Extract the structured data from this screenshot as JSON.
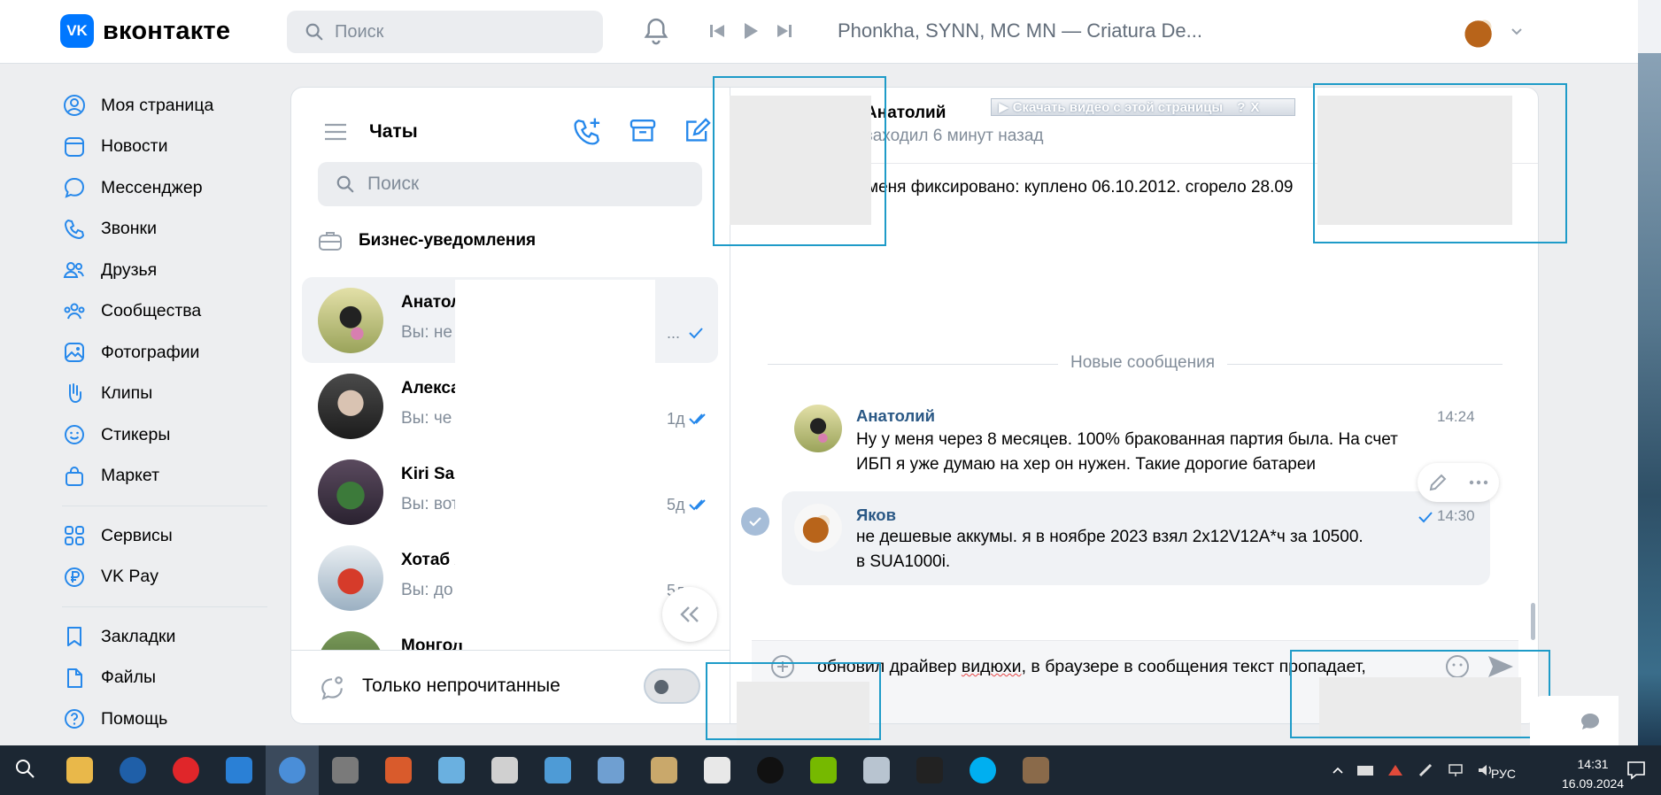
{
  "header": {
    "brand_mark": "VK",
    "brand_name": "вконтакте",
    "search_placeholder": "Поиск",
    "now_playing": "Phonkha, SYNN, MC MN — Criatura De..."
  },
  "nav": {
    "items": [
      {
        "label": "Моя страница",
        "icon": "user-circle-icon"
      },
      {
        "label": "Новости",
        "icon": "newspaper-icon"
      },
      {
        "label": "Мессенджер",
        "icon": "chat-bubble-icon"
      },
      {
        "label": "Звонки",
        "icon": "phone-icon"
      },
      {
        "label": "Друзья",
        "icon": "friends-icon"
      },
      {
        "label": "Сообщества",
        "icon": "communities-icon"
      },
      {
        "label": "Фотографии",
        "icon": "photo-icon"
      },
      {
        "label": "Клипы",
        "icon": "clips-icon"
      },
      {
        "label": "Стикеры",
        "icon": "smile-icon"
      },
      {
        "label": "Маркет",
        "icon": "shopping-bag-icon"
      }
    ],
    "items2": [
      {
        "label": "Сервисы",
        "icon": "grid-icon"
      },
      {
        "label": "VK Pay",
        "icon": "ruble-icon"
      }
    ],
    "items3": [
      {
        "label": "Закладки",
        "icon": "bookmark-icon"
      },
      {
        "label": "Файлы",
        "icon": "file-icon"
      },
      {
        "label": "Помощь",
        "icon": "help-icon"
      }
    ]
  },
  "chats": {
    "title": "Чаты",
    "search_placeholder": "Поиск",
    "business": "Бизнес-уведомления",
    "list": [
      {
        "name": "Анатол",
        "preview": "Вы: не",
        "date": "...",
        "read": "single"
      },
      {
        "name": "Алекса",
        "preview": "Вы: че",
        "date": "1д",
        "read": "double"
      },
      {
        "name": "Kiri Sal",
        "preview": "Вы: вот",
        "date": "5д",
        "read": "double"
      },
      {
        "name": "Хотаб Х",
        "preview": "Вы: до",
        "date": "5д",
        "read": ""
      },
      {
        "name": "Монгол",
        "preview": "",
        "date": "",
        "read": ""
      }
    ],
    "unread_only": "Только непрочитанные"
  },
  "conversation": {
    "name": "Анатолий",
    "status": "заходил 6 минут назад",
    "download_banner": "▶ Скачать видео с этой страницы",
    "banner_help": "?",
    "banner_close": "X",
    "pinned_text": "меня фиксировано: куплено 06.10.2012. сгорело 28.09",
    "new_messages_label": "Новые сообщения",
    "messages": [
      {
        "author": "Анатолий",
        "time": "14:24",
        "text": "Ну у меня через 8 месяцев. 100% бракованная партия была. На счет ИБП я уже думаю на хер он нужен. Такие дорогие батареи"
      },
      {
        "author": "Яков",
        "time": "14:30",
        "text": "не дешевые аккумы. я в ноябре 2023 взял 2х12V12А*ч за 10500.\nв SUA1000i."
      }
    ],
    "composer": {
      "before": "обновил драйвер ",
      "misspelled": "видюхи",
      "after": ", в браузере в сообщения текст пропадает,"
    }
  },
  "taskbar": {
    "apps": [
      {
        "icon": "search-icon",
        "color": "#1c2733"
      },
      {
        "icon": "folder-icon",
        "color": "#e9b84a"
      },
      {
        "icon": "vk-browser-icon",
        "color": "#1f5fa8"
      },
      {
        "icon": "opera-icon",
        "color": "#e0262a"
      },
      {
        "icon": "vk-app-icon",
        "color": "#2a80d6"
      },
      {
        "icon": "browser-globe-icon",
        "color": "#4a8ed8"
      },
      {
        "icon": "media-icon",
        "color": "#7a7a7a"
      },
      {
        "icon": "calendar-icon",
        "color": "#d95b2c"
      },
      {
        "icon": "notes-icon",
        "color": "#6ab0e0"
      },
      {
        "icon": "scratch-icon",
        "color": "#d0d0d0"
      },
      {
        "icon": "book-icon",
        "color": "#4e9bd6"
      },
      {
        "icon": "image-viewer-icon",
        "color": "#6f9fd1"
      },
      {
        "icon": "paint-icon",
        "color": "#c9a86b"
      },
      {
        "icon": "calculator-icon",
        "color": "#e8e8e8"
      },
      {
        "icon": "circle-app-icon",
        "color": "#111111"
      },
      {
        "icon": "nvidia-icon",
        "color": "#76b900"
      },
      {
        "icon": "computer-icon",
        "color": "#b8c4d0"
      },
      {
        "icon": "terminal-icon",
        "color": "#222222"
      },
      {
        "icon": "skype-icon",
        "color": "#00aff0"
      },
      {
        "icon": "photo-app-icon",
        "color": "#8a6a4a"
      }
    ],
    "language": "РУС",
    "time": "14:31",
    "date": "16.09.2024"
  },
  "colors": {
    "accent": "#0077ff",
    "link": "#2a5885",
    "muted": "#818c99",
    "highlight": "#1e9bc8"
  }
}
